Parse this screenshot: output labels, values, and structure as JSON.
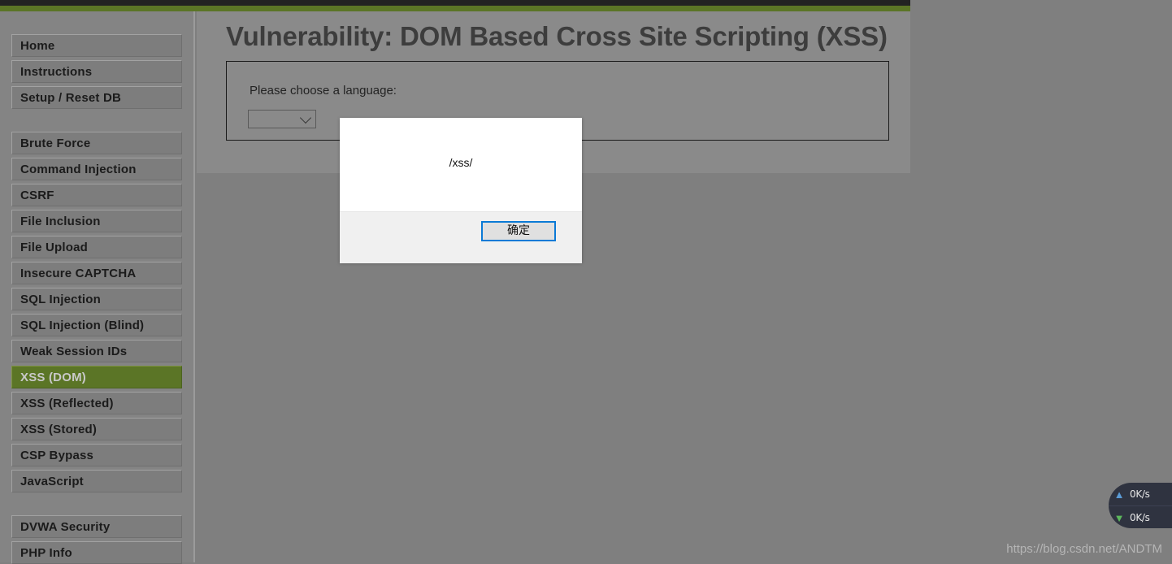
{
  "theme": {
    "topbar_dark": "#222222",
    "topbar_green": "#5b7526",
    "page_bg": "#7f7f7f",
    "sidebar_bg": "#848484",
    "nav_item_bg": "#7d7d7d",
    "nav_active_bg": "#5b7526",
    "content_bg": "#8a8a8a",
    "accent_blue": "#0b7ad6"
  },
  "sidebar": {
    "groups": [
      {
        "items": [
          {
            "label": "Home",
            "active": false
          },
          {
            "label": "Instructions",
            "active": false
          },
          {
            "label": "Setup / Reset DB",
            "active": false
          }
        ]
      },
      {
        "items": [
          {
            "label": "Brute Force",
            "active": false
          },
          {
            "label": "Command Injection",
            "active": false
          },
          {
            "label": "CSRF",
            "active": false
          },
          {
            "label": "File Inclusion",
            "active": false
          },
          {
            "label": "File Upload",
            "active": false
          },
          {
            "label": "Insecure CAPTCHA",
            "active": false
          },
          {
            "label": "SQL Injection",
            "active": false
          },
          {
            "label": "SQL Injection (Blind)",
            "active": false
          },
          {
            "label": "Weak Session IDs",
            "active": false
          },
          {
            "label": "XSS (DOM)",
            "active": true
          },
          {
            "label": "XSS (Reflected)",
            "active": false
          },
          {
            "label": "XSS (Stored)",
            "active": false
          },
          {
            "label": "CSP Bypass",
            "active": false
          },
          {
            "label": "JavaScript",
            "active": false
          }
        ]
      },
      {
        "items": [
          {
            "label": "DVWA Security",
            "active": false
          },
          {
            "label": "PHP Info",
            "active": false
          }
        ]
      }
    ]
  },
  "main": {
    "title": "Vulnerability: DOM Based Cross Site Scripting (XSS)",
    "choose_language_label": "Please choose a language:",
    "language_select": {
      "value": "",
      "icon": "chevron-down-icon"
    }
  },
  "alert_dialog": {
    "message": "/xss/",
    "ok_label": "确定"
  },
  "net_speed_widget": {
    "upload": {
      "icon": "arrow-up-icon",
      "glyph": "▲",
      "value": "0K/s"
    },
    "download": {
      "icon": "arrow-down-icon",
      "glyph": "▼",
      "value": "0K/s"
    }
  },
  "watermark": {
    "text": "https://blog.csdn.net/ANDTM"
  }
}
